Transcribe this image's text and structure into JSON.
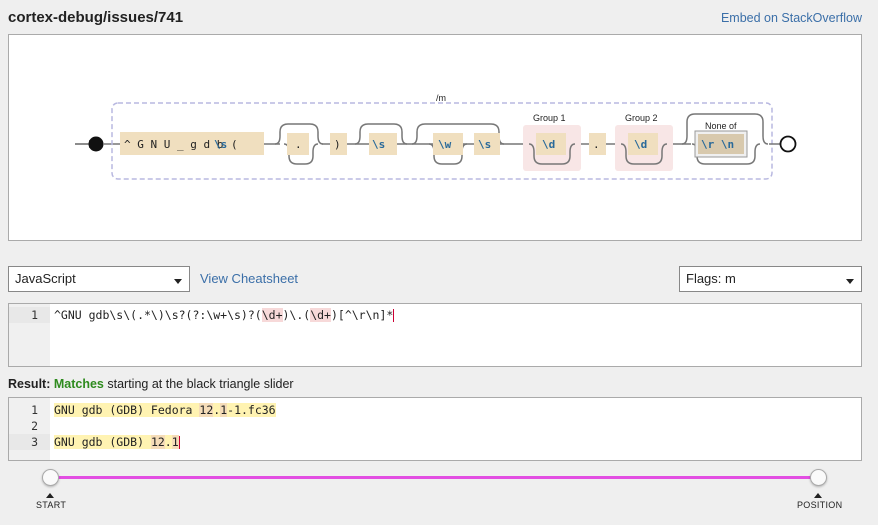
{
  "header": {
    "title": "cortex-debug/issues/741",
    "embed_label": "Embed on StackOverflow"
  },
  "diagram": {
    "flag_label": "/m",
    "nodes": {
      "literal": "^ G N U _ g d b",
      "ws1": "\\s",
      "paren_open": "(",
      "dot_any": ".",
      "paren_close": ")",
      "ws2": "\\s",
      "word": "\\w",
      "ws3": "\\s",
      "group1_label": "Group 1",
      "digit1": "\\d",
      "dot_lit": ".",
      "group2_label": "Group 2",
      "digit2": "\\d",
      "noneof_label": "None of",
      "noneof_chars": "\\r \\n"
    }
  },
  "controls": {
    "flavor": "JavaScript",
    "cheatsheet_label": "View Cheatsheet",
    "flags": "Flags: m"
  },
  "regex": {
    "line_number": "1",
    "p1": "^GNU gdb\\s\\(.*\\)\\s?(?:\\w+\\s)?(",
    "g1": "\\d+",
    "p2": ")\\.(",
    "g2": "\\d+",
    "p3": ")[^\\r\\n]*"
  },
  "result": {
    "prefix": "Result:",
    "status": "Matches",
    "suffix": "starting at the black triangle slider"
  },
  "test_text": {
    "lines": [
      {
        "num": "1",
        "a": "GNU gdb (GDB) Fedora ",
        "b": "12",
        "c": ".",
        "d": "1",
        "e": "-1.fc36"
      },
      {
        "num": "2"
      },
      {
        "num": "3",
        "a": "GNU gdb (GDB) ",
        "b": "12",
        "c": ".",
        "d": "1"
      }
    ]
  },
  "slider": {
    "start_label": "START",
    "position_label": "POSITION",
    "track_color": "#e24ee2"
  }
}
